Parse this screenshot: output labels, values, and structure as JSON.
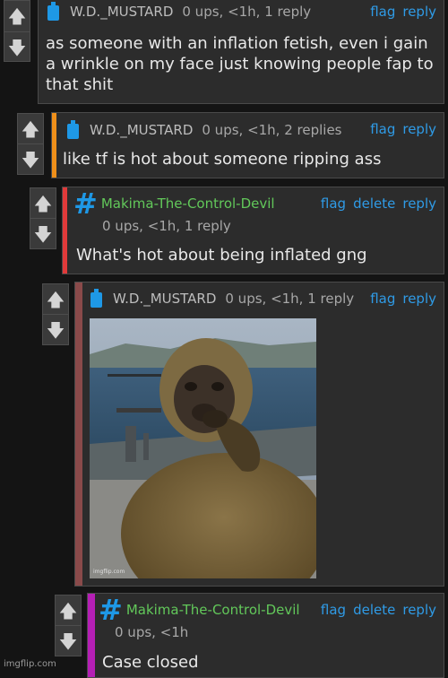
{
  "colors": {
    "accent_link": "#2f9be6",
    "mod_green": "#62c85a",
    "bg": "#141414",
    "card": "#2c2c2c"
  },
  "icons": {
    "upvote": "arrow-up-icon",
    "downvote": "arrow-down-icon",
    "user_badge": "bottle-icon",
    "mod_badge": "hashtag-icon"
  },
  "comments": [
    {
      "username": "W.D._MUSTARD",
      "meta": "0 ups, <1h, 1 reply",
      "actions": [
        "flag",
        "reply"
      ],
      "text": "as someone with an inflation fetish, even i gain a wrinkle on my face just knowing people fap to that shit",
      "stripe_color": ""
    },
    {
      "username": "W.D._MUSTARD",
      "meta": "0 ups, <1h, 2 replies",
      "actions": [
        "flag",
        "reply"
      ],
      "text": "like tf is hot about someone ripping ass",
      "stripe_color": "#f0901a"
    },
    {
      "username": "Makima-The-Control-Devil",
      "meta": "0 ups, <1h, 1 reply",
      "actions": [
        "flag",
        "delete",
        "reply"
      ],
      "text": "What's hot about being inflated gng",
      "stripe_color": "#e03a3a"
    },
    {
      "username": "W.D._MUSTARD",
      "meta": "0 ups, <1h, 1 reply",
      "actions": [
        "flag",
        "reply"
      ],
      "image_watermark": "imgflip.com",
      "stripe_color": "#8a4a4a"
    },
    {
      "username": "Makima-The-Control-Devil",
      "meta": "0 ups, <1h",
      "actions": [
        "flag",
        "delete",
        "reply"
      ],
      "text": "Case closed",
      "stripe_color": "#b51fb5"
    }
  ],
  "watermark": "imgflip.com"
}
